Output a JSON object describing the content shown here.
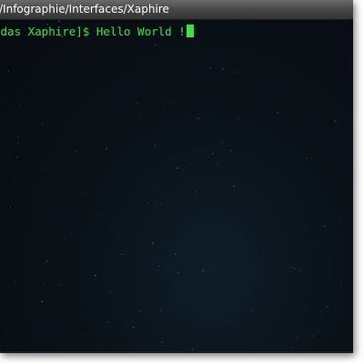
{
  "window": {
    "title": "/Infographie/Interfaces/Xaphire"
  },
  "terminal": {
    "prompt": "idas Xaphire]$ ",
    "command": "Hello World !",
    "text_color": "#33e83a",
    "background_color": "#070d12"
  }
}
